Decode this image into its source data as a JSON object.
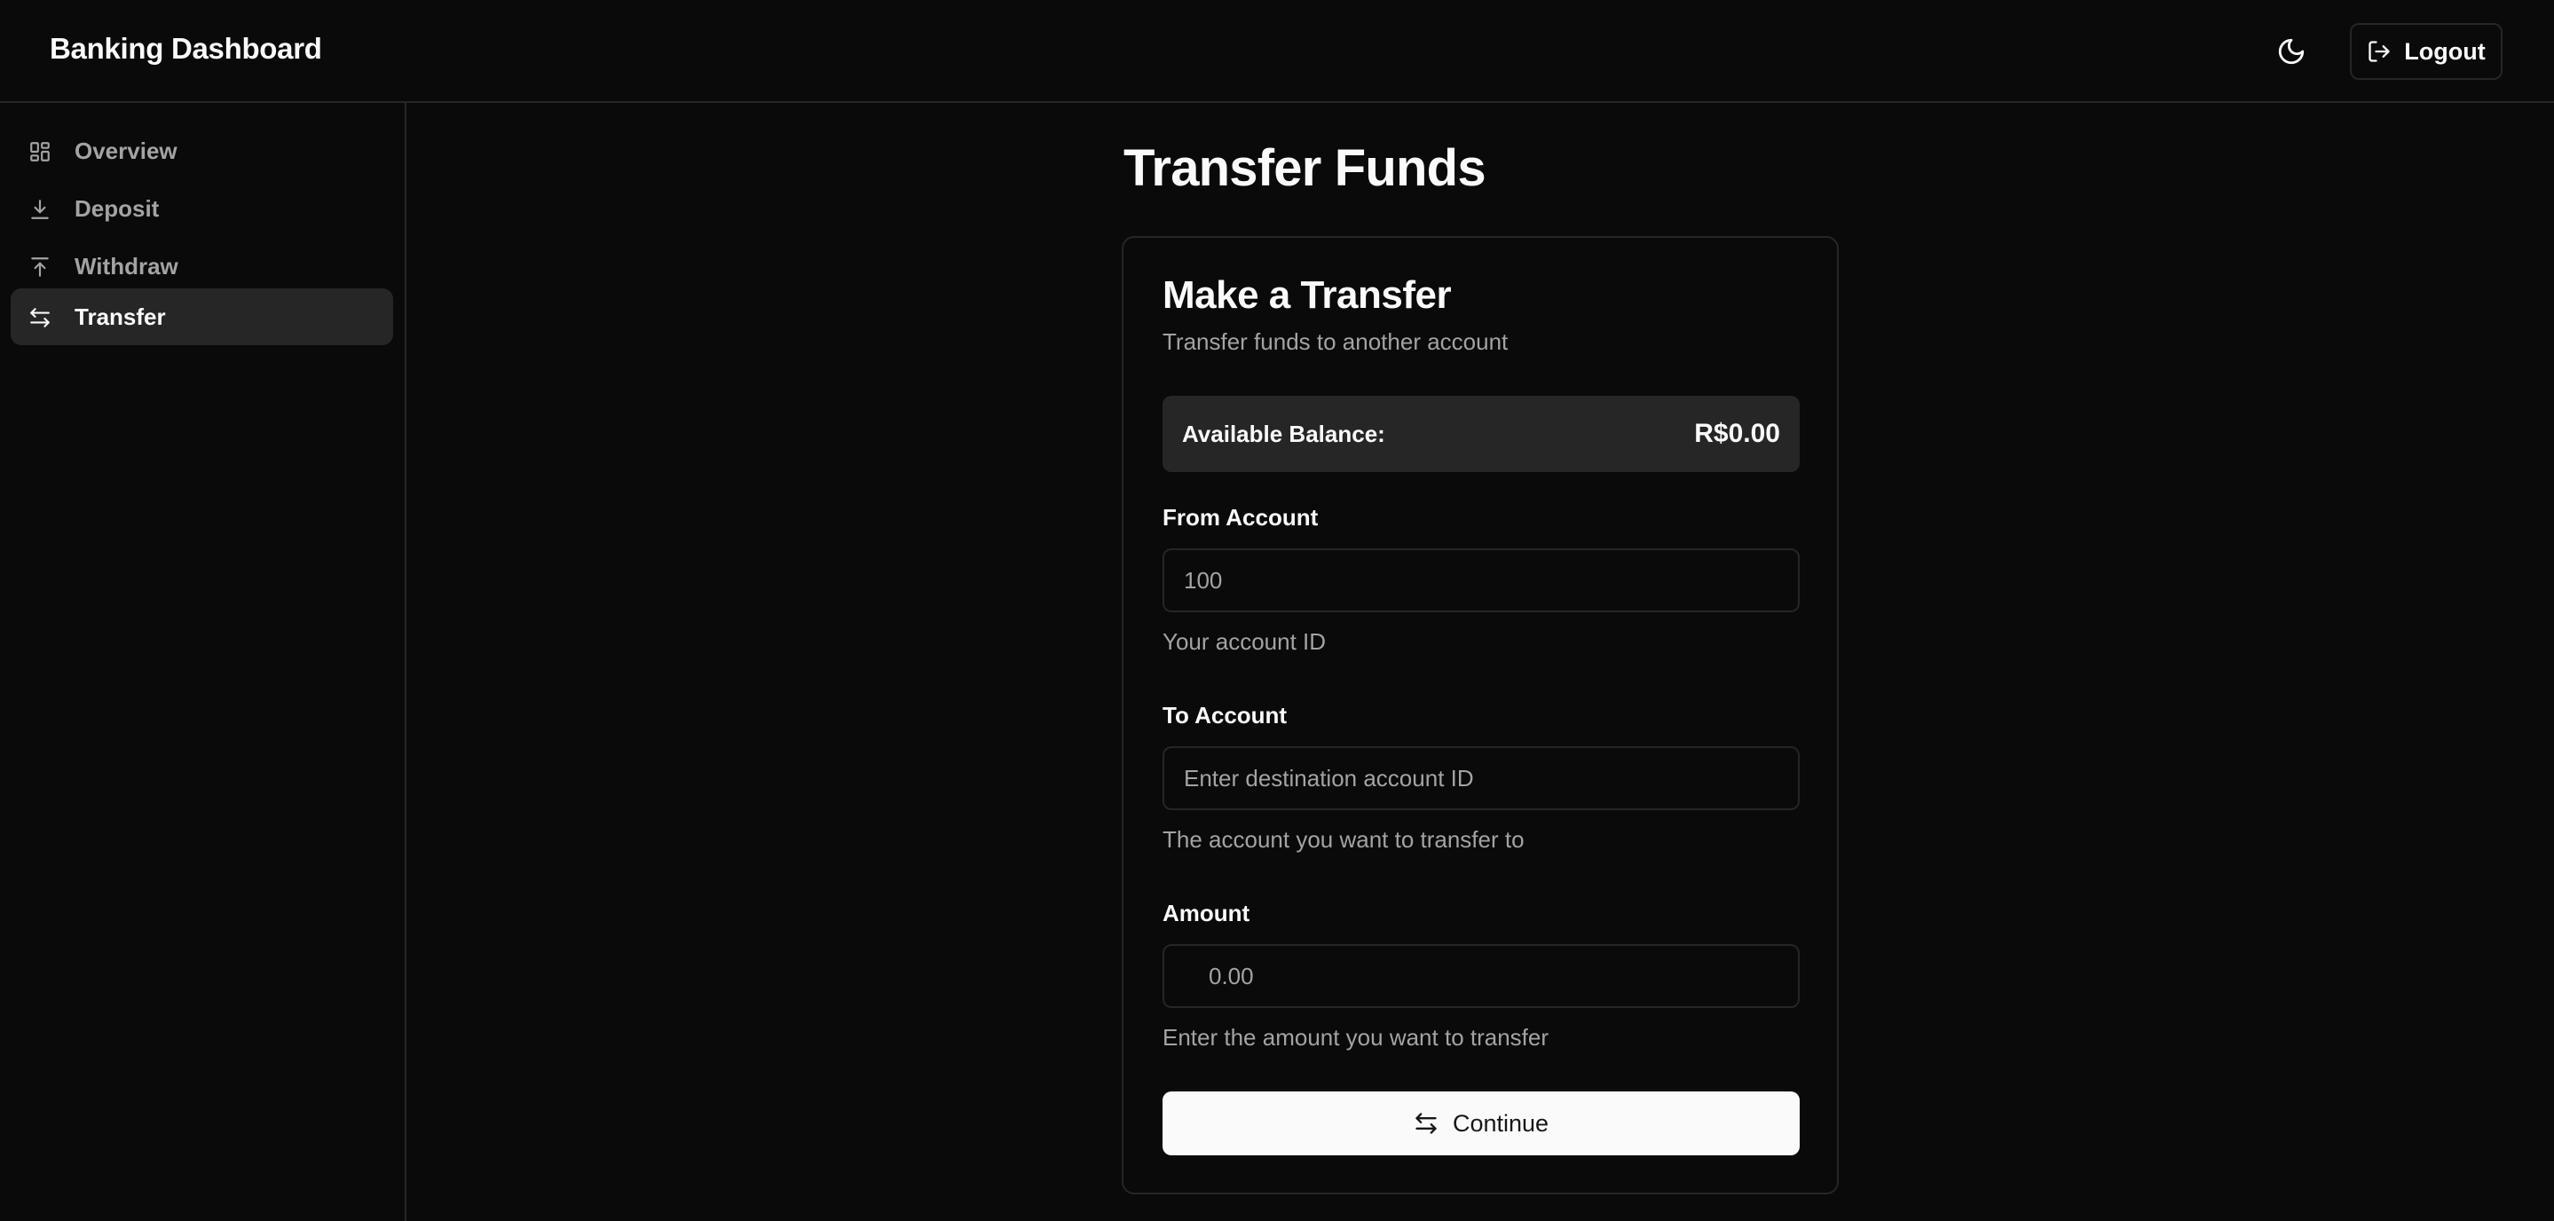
{
  "app": {
    "title": "Banking Dashboard"
  },
  "header": {
    "logout_label": "Logout"
  },
  "sidebar": {
    "items": [
      {
        "label": "Overview",
        "icon": "grid-icon",
        "active": false
      },
      {
        "label": "Deposit",
        "icon": "download-icon",
        "active": false
      },
      {
        "label": "Withdraw",
        "icon": "upload-icon",
        "active": false
      },
      {
        "label": "Transfer",
        "icon": "transfer-arrows-icon",
        "active": true
      }
    ]
  },
  "main": {
    "page_title": "Transfer Funds",
    "card": {
      "title": "Make a Transfer",
      "subtitle": "Transfer funds to another account",
      "balance_label": "Available Balance:",
      "balance_value": "R$0.00",
      "from_account": {
        "label": "From Account",
        "placeholder": "100",
        "help": "Your account ID"
      },
      "to_account": {
        "label": "To Account",
        "placeholder": "Enter destination account ID",
        "help": "The account you want to transfer to"
      },
      "amount": {
        "label": "Amount",
        "placeholder": "0.00",
        "help": "Enter the amount you want to transfer"
      },
      "continue_label": "Continue"
    }
  },
  "colors": {
    "background": "#0a0a0a",
    "border": "#262626",
    "muted_text": "#a3a3a3",
    "foreground": "#fafafa",
    "button_bg": "#fafafa",
    "button_text": "#171717"
  }
}
